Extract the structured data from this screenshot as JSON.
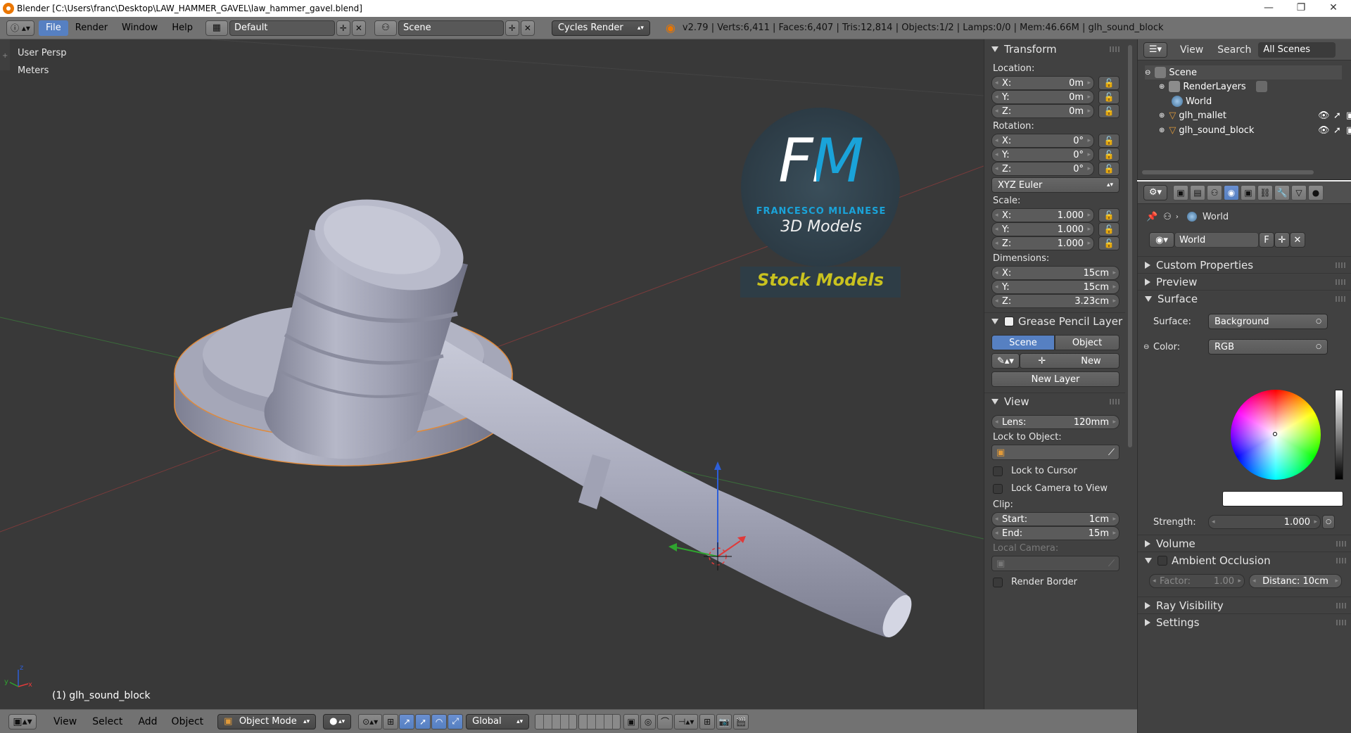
{
  "window": {
    "title": "Blender [C:\\Users\\franc\\Desktop\\LAW_HAMMER_GAVEL\\law_hammer_gavel.blend]",
    "minimize": "—",
    "maximize": "❐",
    "close": "✕"
  },
  "info_header": {
    "menus": [
      "File",
      "Render",
      "Window",
      "Help"
    ],
    "screen_layout": "Default",
    "scene": "Scene",
    "render_engine": "Cycles Render",
    "stats": "v2.79 | Verts:6,411 | Faces:6,407 | Tris:12,814 | Objects:1/2 | Lamps:0/0 | Mem:46.66M | glh_sound_block"
  },
  "viewport": {
    "view_name": "User Persp",
    "units": "Meters",
    "active_object": "(1) glh_sound_block",
    "axis_x": "x",
    "axis_y": "y",
    "axis_z": "z",
    "watermark": {
      "logo": "FM",
      "brand": "FRANCESCO MILANESE",
      "tagline": "3D Models",
      "banner": "Stock Models"
    }
  },
  "transform_panel": {
    "title": "Transform",
    "location_label": "Location:",
    "location": [
      {
        "axis": "X:",
        "value": "0m"
      },
      {
        "axis": "Y:",
        "value": "0m"
      },
      {
        "axis": "Z:",
        "value": "0m"
      }
    ],
    "rotation_label": "Rotation:",
    "rotation": [
      {
        "axis": "X:",
        "value": "0°"
      },
      {
        "axis": "Y:",
        "value": "0°"
      },
      {
        "axis": "Z:",
        "value": "0°"
      }
    ],
    "rotation_mode": "XYZ Euler",
    "scale_label": "Scale:",
    "scale": [
      {
        "axis": "X:",
        "value": "1.000"
      },
      {
        "axis": "Y:",
        "value": "1.000"
      },
      {
        "axis": "Z:",
        "value": "1.000"
      }
    ],
    "dimensions_label": "Dimensions:",
    "dimensions": [
      {
        "axis": "X:",
        "value": "15cm"
      },
      {
        "axis": "Y:",
        "value": "15cm"
      },
      {
        "axis": "Z:",
        "value": "3.23cm"
      }
    ]
  },
  "grease_pencil_panel": {
    "title": "Grease Pencil Layer",
    "tab_scene": "Scene",
    "tab_object": "Object",
    "new": "New",
    "new_layer": "New Layer"
  },
  "view_panel": {
    "title": "View",
    "lens_label": "Lens:",
    "lens_value": "120mm",
    "lock_to_object": "Lock to Object:",
    "lock_to_cursor": "Lock to Cursor",
    "lock_camera_to_view": "Lock Camera to View",
    "clip_label": "Clip:",
    "clip_start_label": "Start:",
    "clip_start": "1cm",
    "clip_end_label": "End:",
    "clip_end": "15m",
    "local_camera": "Local Camera:",
    "render_border": "Render Border"
  },
  "outliner": {
    "view": "View",
    "search": "Search",
    "filter": "All Scenes",
    "items": [
      {
        "label": "Scene"
      },
      {
        "label": "RenderLayers"
      },
      {
        "label": "World"
      },
      {
        "label": "glh_mallet"
      },
      {
        "label": "glh_sound_block"
      }
    ]
  },
  "properties": {
    "breadcrumb": "World",
    "world_name": "World",
    "fake_user": "F",
    "panels": {
      "custom_properties": "Custom Properties",
      "preview": "Preview",
      "surface": "Surface",
      "volume": "Volume",
      "ambient_occlusion": "Ambient Occlusion",
      "ray_visibility": "Ray Visibility",
      "settings": "Settings"
    },
    "surface_label": "Surface:",
    "surface_value": "Background",
    "color_label": "Color:",
    "color_value": "RGB",
    "strength_label": "Strength:",
    "strength_value": "1.000",
    "ao_factor_label": "Factor:",
    "ao_factor_value": "1.00",
    "ao_distance": "Distanc: 10cm"
  },
  "bottom_header": {
    "menus": [
      "View",
      "Select",
      "Add",
      "Object"
    ],
    "mode": "Object Mode",
    "orientation": "Global"
  },
  "colors": {
    "accent": "#5680c2",
    "viewport_bg": "#393939",
    "panel_bg": "#414141",
    "header_bg": "#727272",
    "watermark_gold": "#c9c21f",
    "watermark_blue": "#1aa3d9"
  }
}
